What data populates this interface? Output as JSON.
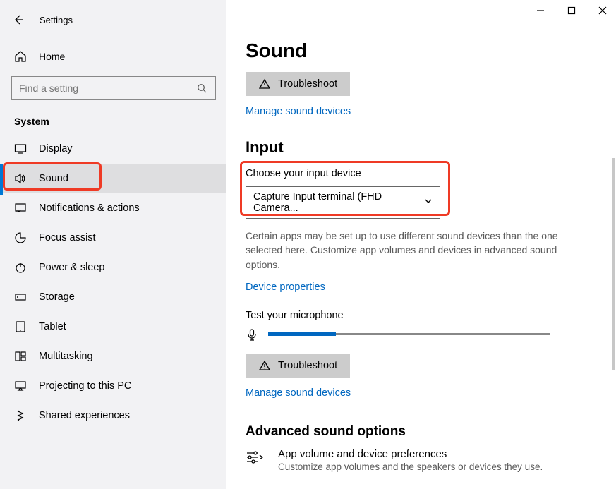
{
  "titlebar": {
    "title": "Settings"
  },
  "sidebar": {
    "home": "Home",
    "search_placeholder": "Find a setting",
    "section": "System",
    "items": [
      {
        "label": "Display"
      },
      {
        "label": "Sound"
      },
      {
        "label": "Notifications & actions"
      },
      {
        "label": "Focus assist"
      },
      {
        "label": "Power & sleep"
      },
      {
        "label": "Storage"
      },
      {
        "label": "Tablet"
      },
      {
        "label": "Multitasking"
      },
      {
        "label": "Projecting to this PC"
      },
      {
        "label": "Shared experiences"
      }
    ]
  },
  "main": {
    "page_title": "Sound",
    "troubleshoot": "Troubleshoot",
    "manage_devices": "Manage sound devices",
    "input": {
      "heading": "Input",
      "choose_label": "Choose your input device",
      "device": "Capture Input terminal (FHD Camera...",
      "helper": "Certain apps may be set up to use different sound devices than the one selected here. Customize app volumes and devices in advanced sound options.",
      "device_properties": "Device properties",
      "test_label": "Test your microphone",
      "mic_level_percent": 24,
      "troubleshoot2": "Troubleshoot",
      "manage2": "Manage sound devices"
    },
    "advanced": {
      "heading": "Advanced sound options",
      "row_title": "App volume and device preferences",
      "row_sub": "Customize app volumes and the speakers or devices they use."
    }
  }
}
